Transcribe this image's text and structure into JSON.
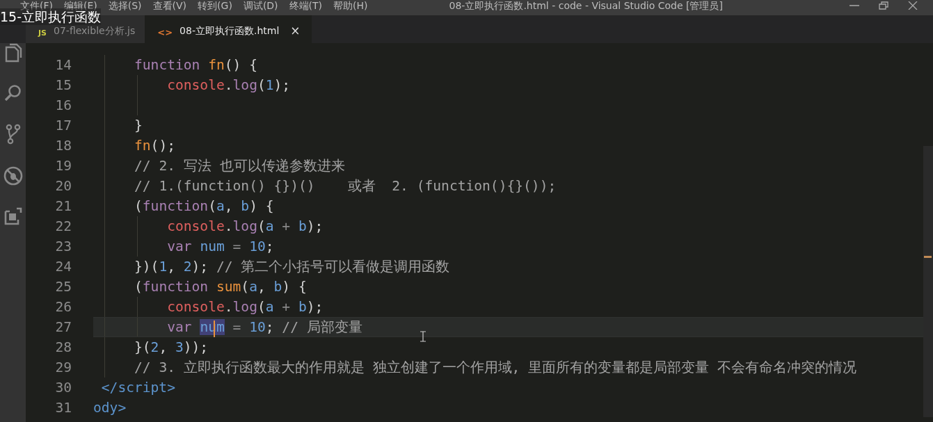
{
  "video_title": "15-立即执行函数",
  "menu": [
    "文件(F)",
    "编辑(E)",
    "选择(S)",
    "查看(V)",
    "转到(G)",
    "调试(D)",
    "终端(T)",
    "帮助(H)"
  ],
  "window": {
    "title": "08-立即执行函数.html - code - Visual Studio Code [管理员]"
  },
  "tabs": [
    {
      "label": "07-flexible分析.js",
      "kind": "js",
      "badge": "JS",
      "selected": false
    },
    {
      "label": "08-立即执行函数.html",
      "kind": "html",
      "badge": "<>",
      "selected": true,
      "close": "×"
    }
  ],
  "activity": [
    {
      "kind": "files",
      "selected": false
    },
    {
      "kind": "search",
      "selected": false
    },
    {
      "kind": "git",
      "selected": false
    },
    {
      "kind": "debug",
      "selected": false
    },
    {
      "kind": "extensions",
      "selected": false
    }
  ],
  "editor": {
    "lines": [
      {
        "number": "14",
        "kind": "body",
        "current": false,
        "tokens": [
          {
            "kind": "keyword",
            "text": "function "
          },
          {
            "kind": "function",
            "text": "fn"
          },
          {
            "kind": "plain",
            "text": "() {"
          }
        ]
      },
      {
        "number": "15",
        "kind": "nested",
        "current": false,
        "tokens": [
          {
            "kind": "object",
            "text": "console"
          },
          {
            "kind": "plain",
            "text": "."
          },
          {
            "kind": "keyword",
            "text": "log"
          },
          {
            "kind": "plain",
            "text": "("
          },
          {
            "kind": "number",
            "text": "1"
          },
          {
            "kind": "plain",
            "text": ");"
          }
        ]
      },
      {
        "number": "16",
        "kind": "nested",
        "current": false
      },
      {
        "number": "17",
        "kind": "body",
        "current": false,
        "tokens": [
          {
            "kind": "plain",
            "text": "}"
          }
        ]
      },
      {
        "number": "18",
        "kind": "body",
        "current": false,
        "tokens": [
          {
            "kind": "function",
            "text": "fn"
          },
          {
            "kind": "plain",
            "text": "();"
          }
        ]
      },
      {
        "number": "19",
        "kind": "body",
        "current": false,
        "tokens": [
          {
            "kind": "comment",
            "text": "// 2. 写法 也可以传递参数进来"
          }
        ]
      },
      {
        "number": "20",
        "kind": "body",
        "current": false,
        "tokens": [
          {
            "kind": "comment",
            "text": "// 1.(function() {})()    或者  2. (function(){}());"
          }
        ]
      },
      {
        "number": "21",
        "kind": "body",
        "current": false,
        "tokens": [
          {
            "kind": "plain",
            "text": "("
          },
          {
            "kind": "keyword",
            "text": "function"
          },
          {
            "kind": "plain",
            "text": "("
          },
          {
            "kind": "variable",
            "text": "a"
          },
          {
            "kind": "plain",
            "text": ", "
          },
          {
            "kind": "variable",
            "text": "b"
          },
          {
            "kind": "plain",
            "text": ") {"
          }
        ]
      },
      {
        "number": "22",
        "kind": "nested",
        "current": false,
        "tokens": [
          {
            "kind": "object",
            "text": "console"
          },
          {
            "kind": "plain",
            "text": "."
          },
          {
            "kind": "keyword",
            "text": "log"
          },
          {
            "kind": "plain",
            "text": "("
          },
          {
            "kind": "variable",
            "text": "a"
          },
          {
            "kind": "operator",
            "text": " + "
          },
          {
            "kind": "variable",
            "text": "b"
          },
          {
            "kind": "plain",
            "text": ");"
          }
        ]
      },
      {
        "number": "23",
        "kind": "nested",
        "current": false,
        "tokens": [
          {
            "kind": "keyword",
            "text": "var "
          },
          {
            "kind": "variable",
            "text": "num"
          },
          {
            "kind": "operator",
            "text": " = "
          },
          {
            "kind": "number",
            "text": "10"
          },
          {
            "kind": "plain",
            "text": ";"
          }
        ]
      },
      {
        "number": "24",
        "kind": "body",
        "current": false,
        "tokens": [
          {
            "kind": "plain",
            "text": "})("
          },
          {
            "kind": "number",
            "text": "1"
          },
          {
            "kind": "plain",
            "text": ", "
          },
          {
            "kind": "number",
            "text": "2"
          },
          {
            "kind": "plain",
            "text": "); "
          },
          {
            "kind": "comment",
            "text": "// 第二个小括号可以看做是调用函数"
          }
        ]
      },
      {
        "number": "25",
        "kind": "body",
        "current": false,
        "tokens": [
          {
            "kind": "plain",
            "text": "("
          },
          {
            "kind": "keyword",
            "text": "function "
          },
          {
            "kind": "function",
            "text": "sum"
          },
          {
            "kind": "plain",
            "text": "("
          },
          {
            "kind": "variable",
            "text": "a"
          },
          {
            "kind": "plain",
            "text": ", "
          },
          {
            "kind": "variable",
            "text": "b"
          },
          {
            "kind": "plain",
            "text": ") {"
          }
        ]
      },
      {
        "number": "26",
        "kind": "nested",
        "current": false,
        "tokens": [
          {
            "kind": "object",
            "text": "console"
          },
          {
            "kind": "plain",
            "text": "."
          },
          {
            "kind": "keyword",
            "text": "log"
          },
          {
            "kind": "plain",
            "text": "("
          },
          {
            "kind": "variable",
            "text": "a"
          },
          {
            "kind": "operator",
            "text": " + "
          },
          {
            "kind": "variable",
            "text": "b"
          },
          {
            "kind": "plain",
            "text": ");"
          }
        ]
      },
      {
        "number": "27",
        "kind": "nested",
        "current": true,
        "tokens": [
          {
            "kind": "keyword",
            "text": "var "
          },
          {
            "kind": "variable",
            "text": "num",
            "selected": true
          },
          {
            "kind": "operator",
            "text": " = "
          },
          {
            "kind": "number",
            "text": "10"
          },
          {
            "kind": "plain",
            "text": "; "
          },
          {
            "kind": "comment",
            "text": "// 局部变量"
          }
        ]
      },
      {
        "number": "28",
        "kind": "body",
        "current": false,
        "tokens": [
          {
            "kind": "plain",
            "text": "}("
          },
          {
            "kind": "number",
            "text": "2"
          },
          {
            "kind": "plain",
            "text": ", "
          },
          {
            "kind": "number",
            "text": "3"
          },
          {
            "kind": "plain",
            "text": "));"
          }
        ]
      },
      {
        "number": "29",
        "kind": "body",
        "current": false,
        "tokens": [
          {
            "kind": "comment",
            "text": "// 3. 立即执行函数最大的作用就是 独立创建了一个作用域, 里面所有的变量都是局部变量 不会有命名冲突的情况"
          }
        ]
      },
      {
        "number": "30",
        "kind": "script",
        "current": false,
        "tokens": [
          {
            "kind": "tag",
            "text": "</script>"
          }
        ]
      },
      {
        "number": "31",
        "kind": "root",
        "current": false,
        "tokens": [
          {
            "kind": "tag",
            "text": "ody>"
          }
        ]
      }
    ]
  }
}
